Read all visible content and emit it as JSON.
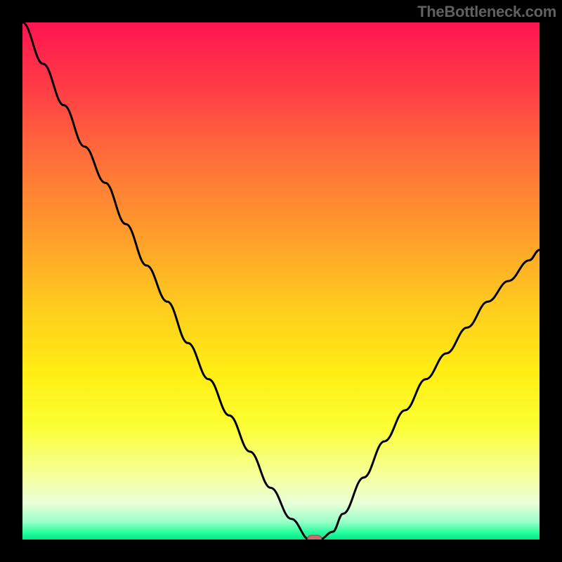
{
  "watermark": "TheBottleneck.com",
  "colors": {
    "frame": "#000000",
    "watermark_text": "#606060",
    "curve": "#000000",
    "marker_fill": "#c76f6f",
    "marker_stroke": "#9a4a4a",
    "gradient_stops": [
      {
        "offset": 0.0,
        "color": "#ff1452"
      },
      {
        "offset": 0.12,
        "color": "#ff3a47"
      },
      {
        "offset": 0.25,
        "color": "#ff6a3a"
      },
      {
        "offset": 0.4,
        "color": "#ff9a2d"
      },
      {
        "offset": 0.55,
        "color": "#ffcc1e"
      },
      {
        "offset": 0.68,
        "color": "#ffee14"
      },
      {
        "offset": 0.78,
        "color": "#fbff33"
      },
      {
        "offset": 0.88,
        "color": "#f6ffa0"
      },
      {
        "offset": 0.93,
        "color": "#e8ffd9"
      },
      {
        "offset": 0.965,
        "color": "#9dffc9"
      },
      {
        "offset": 0.985,
        "color": "#2dffa0"
      },
      {
        "offset": 1.0,
        "color": "#00e889"
      }
    ]
  },
  "chart_data": {
    "type": "line",
    "title": "",
    "xlabel": "",
    "ylabel": "",
    "x": [
      0.0,
      0.04,
      0.08,
      0.12,
      0.16,
      0.2,
      0.24,
      0.28,
      0.32,
      0.36,
      0.4,
      0.44,
      0.48,
      0.52,
      0.555,
      0.575,
      0.6,
      0.62,
      0.66,
      0.7,
      0.74,
      0.78,
      0.82,
      0.86,
      0.9,
      0.94,
      0.98,
      1.0
    ],
    "values": [
      1.0,
      0.92,
      0.84,
      0.76,
      0.69,
      0.61,
      0.53,
      0.46,
      0.38,
      0.31,
      0.24,
      0.17,
      0.1,
      0.04,
      0.0,
      0.0,
      0.015,
      0.05,
      0.12,
      0.19,
      0.25,
      0.31,
      0.36,
      0.41,
      0.46,
      0.5,
      0.54,
      0.56
    ],
    "xlim": [
      0,
      1
    ],
    "ylim": [
      0,
      1
    ],
    "marker": {
      "x": 0.565,
      "y": 0.0,
      "shape": "rounded-rect"
    }
  }
}
